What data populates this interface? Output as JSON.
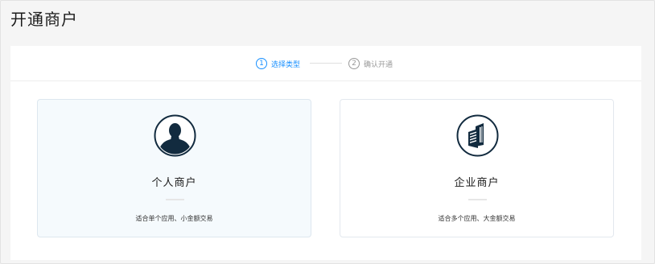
{
  "page": {
    "title": "开通商户"
  },
  "steps": [
    {
      "number": "1",
      "label": "选择类型",
      "state": "active"
    },
    {
      "number": "2",
      "label": "确认开通",
      "state": "pending"
    }
  ],
  "merchant_types": [
    {
      "title": "个人商户",
      "description": "适合单个应用、小金额交易",
      "icon": "person-avatar-icon",
      "selected": true
    },
    {
      "title": "企业商户",
      "description": "适合多个应用、大金额交易",
      "icon": "building-icon",
      "selected": false
    }
  ],
  "colors": {
    "accent": "#1890ff",
    "icon_fill": "#122b3f",
    "selected_card_bg": "#f5fafd",
    "inactive_step": "#999999"
  }
}
